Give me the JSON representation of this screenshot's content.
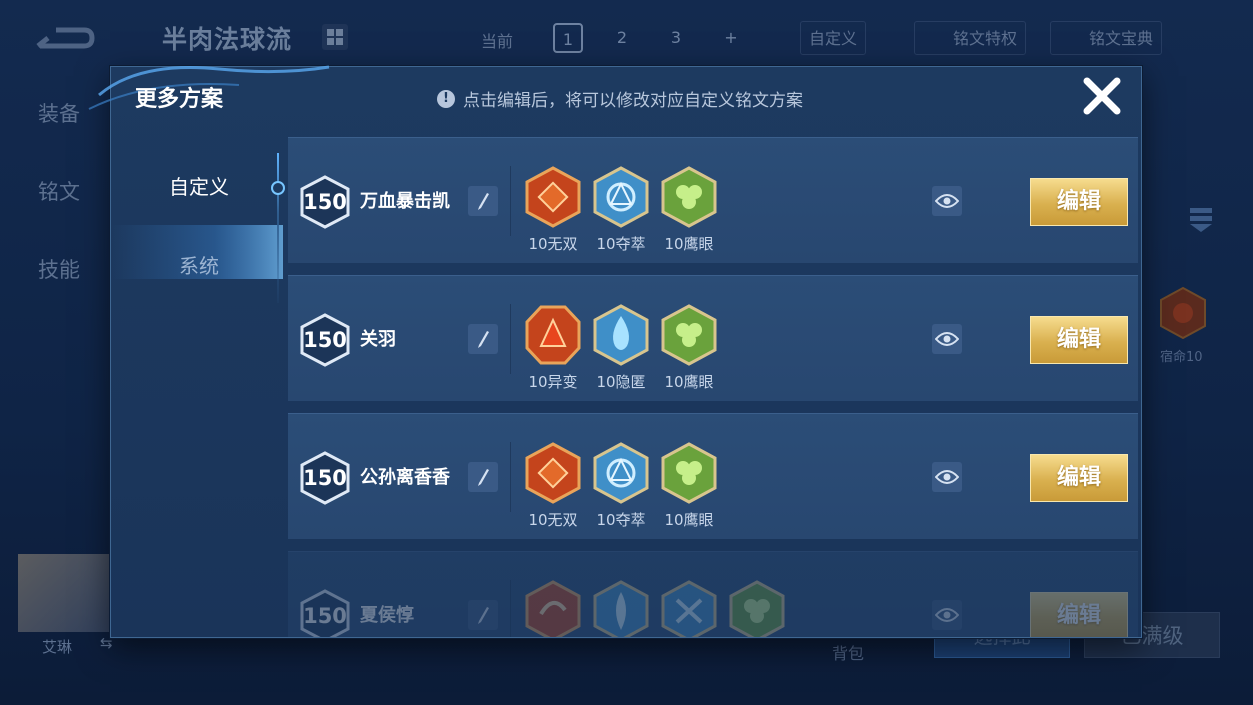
{
  "background": {
    "title": "半肉法球流",
    "current_label": "当前",
    "page_numbers": [
      "1",
      "2",
      "3",
      "+"
    ],
    "active_page": "1",
    "custom_label": "自定义",
    "privilege_label": "铭文特权",
    "collection_label": "铭文宝典",
    "side_tabs": [
      "装备",
      "铭文",
      "技能"
    ],
    "rune_label": "宿命10",
    "hero_name": "艾琳",
    "bag_label": "背包",
    "select_button": "选择此",
    "maxed_button": "已满级"
  },
  "modal": {
    "title": "更多方案",
    "notice": "点击编辑后，将可以修改对应自定义铭文方案",
    "tabs": [
      {
        "label": "自定义",
        "active": true
      },
      {
        "label": "系统",
        "active": false
      }
    ],
    "edit_label": "编辑",
    "plans": [
      {
        "level": "150",
        "name": "万血暴击凯",
        "runes": [
          {
            "icon": "red-diamond-rune-icon",
            "label": "10无双"
          },
          {
            "icon": "blue-knot-rune-icon",
            "label": "10夺萃"
          },
          {
            "icon": "green-clover-rune-icon",
            "label": "10鹰眼"
          }
        ]
      },
      {
        "level": "150",
        "name": "关羽",
        "runes": [
          {
            "icon": "red-arrow-rune-icon",
            "label": "10异变"
          },
          {
            "icon": "blue-flame-rune-icon",
            "label": "10隐匿"
          },
          {
            "icon": "green-clover-rune-icon",
            "label": "10鹰眼"
          }
        ]
      },
      {
        "level": "150",
        "name": "公孙离香香",
        "runes": [
          {
            "icon": "red-diamond-rune-icon",
            "label": "10无双"
          },
          {
            "icon": "blue-knot-rune-icon",
            "label": "10夺萃"
          },
          {
            "icon": "green-clover-rune-icon",
            "label": "10鹰眼"
          }
        ]
      },
      {
        "level": "150",
        "name": "夏侯惇",
        "runes": [
          {
            "icon": "red-swirl-rune-icon",
            "label": ""
          },
          {
            "icon": "blue-leaf-rune-icon",
            "label": ""
          },
          {
            "icon": "blue-cross-rune-icon",
            "label": ""
          },
          {
            "icon": "green-clover-rune-icon",
            "label": ""
          }
        ]
      }
    ]
  },
  "colors": {
    "gold_button": "#d9b04f",
    "accent_blue": "#77c6ff",
    "panel": "#1d3a60"
  }
}
